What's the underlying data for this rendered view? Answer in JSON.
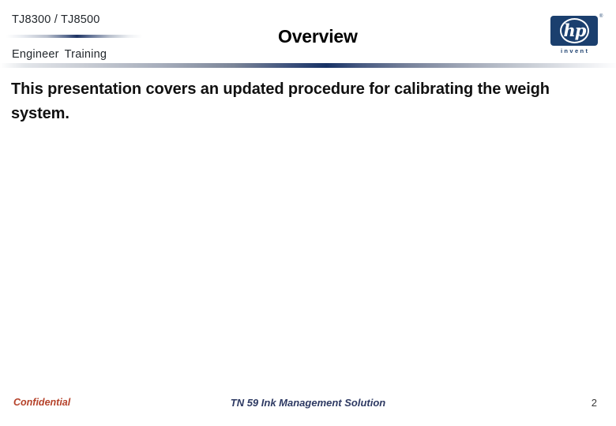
{
  "header": {
    "product_line": "TJ8300 / TJ8500",
    "audience_word_1": "Engineer",
    "audience_word_2": "Training",
    "title": "Overview",
    "logo": {
      "wordmark": "hp",
      "tagline": "invent",
      "trademark": "®",
      "brand_color": "#1b3f6e"
    },
    "rule_accent_color": "#163164"
  },
  "content": {
    "paragraph": "This presentation covers an updated procedure for calibrating the weigh system."
  },
  "footer": {
    "classification": "Confidential",
    "classification_color": "#b5422a",
    "document_title": "TN 59 Ink Management Solution",
    "document_title_color": "#2e3a63",
    "page_number": "2"
  }
}
